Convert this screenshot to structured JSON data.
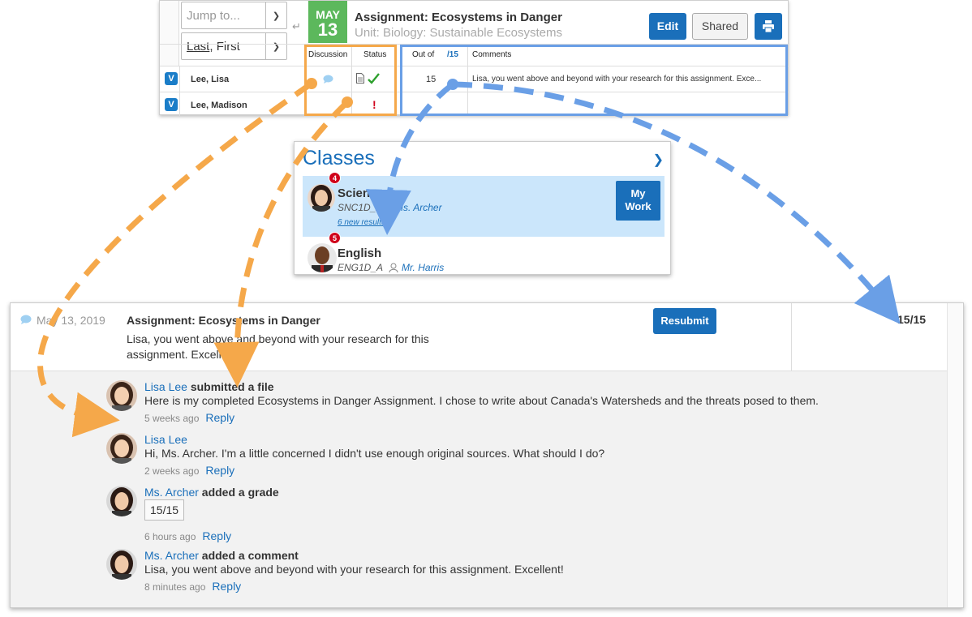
{
  "colors": {
    "brand_blue": "#1a6fba",
    "date_green": "#5cb85c",
    "orange_callout": "#f5a84a",
    "blue_callout": "#6a9fe6",
    "alert_red": "#d0021b"
  },
  "gradebook": {
    "jump_placeholder": "Jump to...",
    "sort_prefix": "Last",
    "sort_suffix": ", First",
    "date_month": "MAY",
    "date_day": "13",
    "assignment_title": "Assignment: Ecosystems in Danger",
    "unit": "Unit: Biology: Sustainable Ecosystems",
    "edit_label": "Edit",
    "shared_label": "Shared",
    "print_icon": "print-icon",
    "columns": {
      "discussion": "Discussion",
      "status": "Status",
      "out_of": "Out of",
      "out_of_max": "/15",
      "comments": "Comments"
    },
    "students": [
      {
        "badge": "V",
        "name": "Lee, Lisa",
        "score": "15",
        "comment": "Lisa, you went above and beyond with your research for this assignment. Exce...",
        "status_icons": [
          "file-icon",
          "checkmark-icon"
        ],
        "discussion_icon": "chat-bubble-icon"
      },
      {
        "badge": "V",
        "name": "Lee, Madison",
        "score": "",
        "comment": "",
        "status_icons": [
          "exclamation-icon"
        ],
        "status_text": "!"
      }
    ]
  },
  "classes": {
    "title": "Classes",
    "items": [
      {
        "name": "Science",
        "code": "SNC1D_A",
        "teacher": "Ms. Archer",
        "badge": "4",
        "link": "6 new results",
        "selected": true
      },
      {
        "name": "English",
        "code": "ENG1D_A",
        "teacher": "Mr. Harris",
        "badge": "5"
      }
    ],
    "my_work_label_1": "My",
    "my_work_label_2": "Work"
  },
  "student_view": {
    "date": "May 13, 2019",
    "title": "Assignment: Ecosystems in Danger",
    "comment": "Lisa, you went above and beyond with your research for this assignment. Excellent!",
    "resubmit_label": "Resubmit",
    "grade": "15/15",
    "feed": [
      {
        "who": "Lisa Lee",
        "action": " submitted a file",
        "body": "Here is my completed Ecosystems in Danger Assignment. I chose to write about Canada's Watersheds and the threats posed to them.",
        "time": "5 weeks ago",
        "reply": "Reply"
      },
      {
        "who": "Lisa Lee",
        "action": "",
        "body": "Hi, Ms. Archer. I'm a little concerned I didn't use enough original sources. What should I do?",
        "time": "2 weeks ago",
        "reply": "Reply"
      },
      {
        "who": "Ms. Archer",
        "action": " added a grade",
        "body": "15/15",
        "time": "6 hours ago",
        "reply": "Reply"
      },
      {
        "who": "Ms. Archer",
        "action": " added a comment",
        "body": "Lisa, you went above and beyond with your research for this assignment. Excellent!",
        "time": "8 minutes ago",
        "reply": "Reply"
      }
    ]
  }
}
